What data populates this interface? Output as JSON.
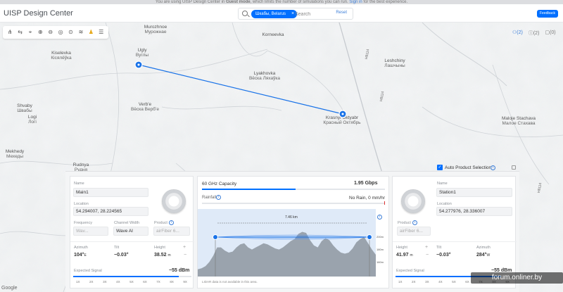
{
  "banner": {
    "text_pre": "You are using UISP Design Center in",
    "mode": "Guest mode",
    "text_mid": ", which limits the number of simulations you can run.",
    "signin": "Sign in",
    "text_post": "for the best experience."
  },
  "header": {
    "title": "UISP Design Center",
    "search_chip": "Шкабы, Belarus",
    "search_placeholder": "Search",
    "reset_label": "Reset",
    "feedback_label": "Feedback"
  },
  "map_tools": {
    "icons": [
      "topology-icon",
      "link-icon",
      "tower-icon",
      "zoom-in-icon",
      "zoom-out-icon",
      "locate-icon",
      "crosshair-icon",
      "layers-icon",
      "pegman-icon",
      "settings-icon"
    ],
    "right": [
      {
        "icon": "devices-icon",
        "count": "(2)"
      },
      {
        "icon": "help-icon",
        "count": "(2)"
      },
      {
        "icon": "box-icon",
        "count": "(0)"
      }
    ]
  },
  "places": [
    {
      "name": "Murozhnoe",
      "cyr": "Мурожнае"
    },
    {
      "name": "Korneevka",
      "cyr": ""
    },
    {
      "name": "Kiselevka",
      "cyr": "Кiсялёўка"
    },
    {
      "name": "Ugly",
      "cyr": "Вуглы"
    },
    {
      "name": "Lyakhovka",
      "cyr": "Вёска Ляхаўка"
    },
    {
      "name": "Leshchiny",
      "cyr": "Лашчыны"
    },
    {
      "name": "Verb'e",
      "cyr": "Вёска Вербʼе"
    },
    {
      "name": "Shvaby",
      "cyr": "Швабы"
    },
    {
      "name": "Logi",
      "cyr": "Логi"
    },
    {
      "name": "Krasnyi Oktyabr",
      "cyr": "Красный Октябрь"
    },
    {
      "name": "Maloje Stachava",
      "cyr": "Малое Стахава"
    },
    {
      "name": "Mekhedy",
      "cyr": "Мехеды"
    },
    {
      "name": "Rudnya",
      "cyr": "Рудня"
    }
  ],
  "roads": [
    "H8114",
    "H8114",
    "H8114"
  ],
  "device_a": {
    "name_label": "Name",
    "name": "Main1",
    "location_label": "Location",
    "location": "54.294007, 28.224565",
    "frequency_label": "Frequency",
    "frequency": "Wav...",
    "channel_label": "Channel Width",
    "channel": "Wave AI",
    "product_label": "Product",
    "product": "airFiber 6...",
    "azimuth_label": "Azimuth",
    "azimuth": "104°",
    "azimuth_unit": "E",
    "tilt_label": "Tilt",
    "tilt": "−0.03°",
    "height_label": "Height",
    "height": "38.52",
    "height_unit": "m",
    "signal_label": "Expected Signal",
    "signal": "−55 dBm",
    "signal_level": 0.89,
    "ticks": [
      "1X",
      "2X",
      "3X",
      "4X",
      "5X",
      "6X",
      "7X",
      "8X",
      "9X"
    ]
  },
  "link": {
    "capacity_label": "60 GHz Capacity",
    "capacity": "1.95 Gbps",
    "capacity_level": 0.51,
    "rainfall_label": "Rainfall",
    "rainfall": "No Rain, 0 mm/hr",
    "distance": "7.46 km",
    "profile_labels": [
      "200m",
      "180m",
      "160m"
    ],
    "profile_elevation": [
      147,
      148,
      150,
      154,
      160,
      168,
      168,
      165,
      163,
      164,
      168,
      171,
      172,
      168,
      166,
      168,
      170,
      172,
      171,
      169,
      167,
      166,
      168,
      171,
      174,
      176,
      181,
      183,
      182,
      175,
      170,
      168,
      174,
      177,
      175,
      170,
      166,
      163,
      162,
      163,
      167,
      173,
      176,
      178,
      172,
      166,
      161
    ],
    "lidar_note": "LIDAR data is not available in this area."
  },
  "device_b": {
    "auto_label": "Auto Product Selection",
    "name_label": "Name",
    "name": "Station1",
    "location_label": "Location",
    "location": "54.277976, 28.336007",
    "product_label": "Product",
    "product": "airFiber 6...",
    "height_label": "Height",
    "height": "41.97",
    "height_unit": "m",
    "tilt_label": "Tilt",
    "tilt": "−0.03°",
    "azimuth_label": "Azimuth",
    "azimuth": "284°",
    "azimuth_unit": "W",
    "signal_label": "Expected Signal",
    "signal": "−55 dBm",
    "signal_level": 0.89,
    "ticks": [
      "1X",
      "2X",
      "3X",
      "4X",
      "5X",
      "6X",
      "7X",
      "8X",
      "9X"
    ]
  },
  "watermark": "forum.onliner.by",
  "google": "Google"
}
